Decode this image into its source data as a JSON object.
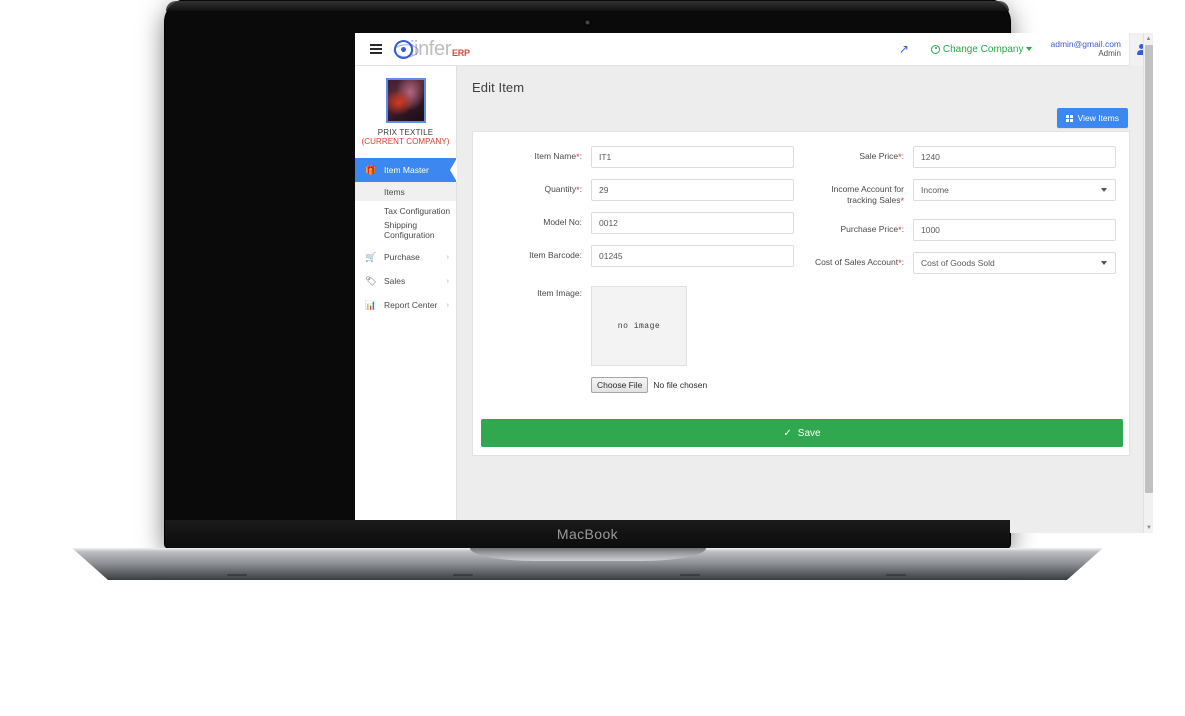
{
  "device": {
    "label": "MacBook"
  },
  "navbar": {
    "menu_toggle_icon": "hamburger-icon",
    "brand_name": "iinfer",
    "brand_suffix": "ERP",
    "expand_icon": "↗",
    "change_company_label": "Change Company",
    "user_email": "admin@gmail.com",
    "user_role": "Admin",
    "avatar_icon": "user-icon"
  },
  "sidebar": {
    "company_name": "PRIX TEXTILE",
    "company_status": "(CURRENT COMPANY)",
    "menu": [
      {
        "label": "Item Master",
        "icon": "gift-icon",
        "active": true,
        "has_chevron": false
      },
      {
        "label": "Purchase",
        "icon": "cart-icon",
        "active": false,
        "has_chevron": true
      },
      {
        "label": "Sales",
        "icon": "tag-icon",
        "active": false,
        "has_chevron": true
      },
      {
        "label": "Report Center",
        "icon": "bar-chart-icon",
        "active": false,
        "has_chevron": true
      }
    ],
    "submenu": [
      {
        "label": "Items",
        "selected": true
      },
      {
        "label": "Tax Configuration",
        "selected": false
      },
      {
        "label": "Shipping Configuration",
        "selected": false
      }
    ]
  },
  "main": {
    "page_title": "Edit Item",
    "view_items_label": "View Items",
    "save_label": "Save",
    "left_fields": [
      {
        "label": "Item Name",
        "required": true,
        "value": "IT1",
        "type": "text"
      },
      {
        "label": "Quantity",
        "required": true,
        "value": "29",
        "type": "text"
      },
      {
        "label": "Model No:",
        "required": false,
        "value": "0012",
        "type": "text"
      },
      {
        "label": "Item Barcode:",
        "required": false,
        "value": "01245",
        "type": "text"
      }
    ],
    "right_fields": [
      {
        "label": "Sale Price",
        "required": true,
        "value": "1240",
        "type": "text"
      },
      {
        "label": "Income Account for tracking Sales",
        "required": true,
        "value": "Income",
        "type": "select"
      },
      {
        "label": "Purchase Price",
        "required": true,
        "value": "1000",
        "type": "text"
      },
      {
        "label": "Cost of Sales Account",
        "required": true,
        "value": "Cost of Goods Sold",
        "type": "select"
      }
    ],
    "image_field": {
      "label": "Item Image:",
      "placeholder_text": "no image",
      "choose_file_label": "Choose File",
      "no_file_label": "No file chosen"
    }
  },
  "colors": {
    "primary_blue": "#3c87f0",
    "brand_blue": "#3a5bd9",
    "green": "#2fa84f",
    "change_company_green": "#2aa84a",
    "red": "#e03b2f",
    "page_bg": "#ededed"
  }
}
